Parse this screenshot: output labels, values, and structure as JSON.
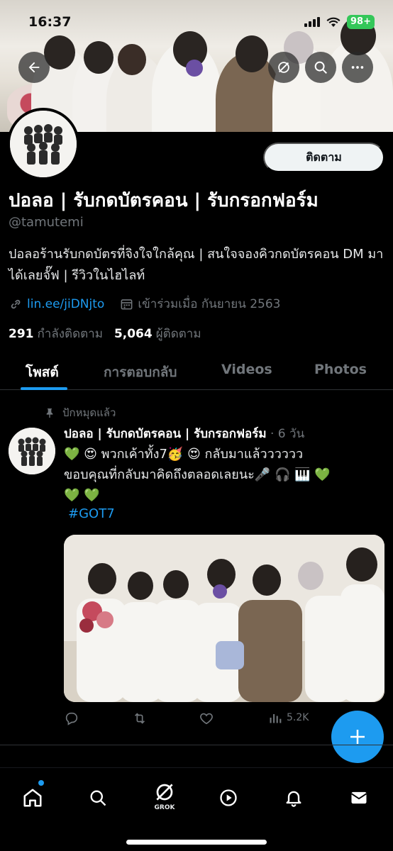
{
  "status_bar": {
    "time": "16:37",
    "battery": "98+"
  },
  "header": {
    "back_icon": "arrow-left-icon",
    "grok_icon": "grok-slash-icon",
    "search_icon": "search-icon",
    "more_icon": "more-horizontal-icon"
  },
  "profile": {
    "follow_label": "ติดตาม",
    "name": "ปอลอ | รับกดบัตรคอน | รับกรอกฟอร์ม",
    "handle": "@tamutemi",
    "bio": "ปอลอร้านรับกดบัตรที่จิงใจใกล้คุณ | สนใจจองคิวกดบัตรคอน DM มาได้เลยจั๊ฟ | รีวิวในไฮไลท์",
    "link": "lin.ee/jiDNjto",
    "joined": "เข้าร่วมเมื่อ กันยายน 2563",
    "following_count": "291",
    "following_label": "กำลังติดตาม",
    "followers_count": "5,064",
    "followers_label": "ผู้ติดตาม"
  },
  "tabs": [
    {
      "label": "โพสต์"
    },
    {
      "label": "การตอบกลับ"
    },
    {
      "label": "Videos"
    },
    {
      "label": "Photos"
    }
  ],
  "tweet": {
    "pinned_label": "ปักหมุดแล้ว",
    "author": "ปอลอ | รับกดบัตรคอน | รับกรอกฟอร์ม",
    "age": "6 วัน",
    "line1": "💚 😍 พวกเค้าทั้ง7🥳 😍 กลับมาแล้วววววว",
    "line2": "ขอบคุณที่กลับมาคิดถึงตลอดเลยนะ🎤 🎧 🎹 💚",
    "line3": "💚 💚",
    "hashtag": "#GOT7",
    "views": "5.2K"
  },
  "nav": {
    "grok_label": "GROK"
  },
  "colors": {
    "accent": "#1d9bf0",
    "muted": "#71767b",
    "background": "#000000"
  }
}
